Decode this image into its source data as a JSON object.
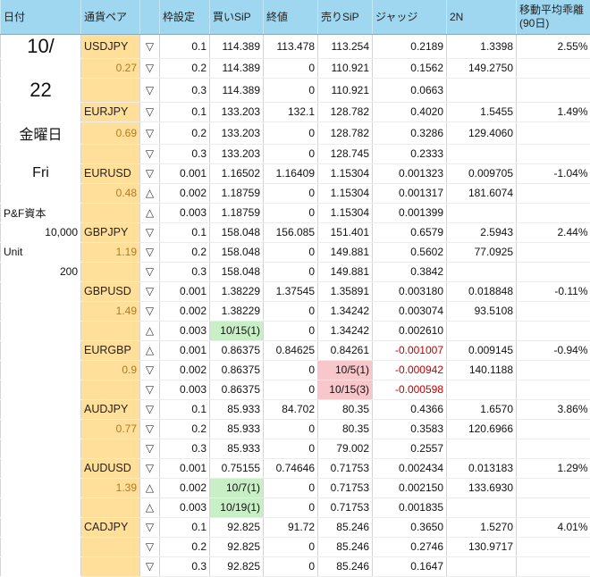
{
  "headers": [
    "日付",
    "通貨ペア",
    "",
    "枠設定",
    "買いSiP",
    "終値",
    "売りSiP",
    "ジャッジ",
    "2N",
    "移動平均乖離(90日)"
  ],
  "sidebar": [
    "10/",
    "",
    "22",
    "",
    "金曜日",
    "",
    "Fri",
    "",
    "P&F資本",
    "10,000",
    "Unit",
    "200"
  ],
  "colors": {
    "header": "#9fd7f0",
    "pair": "#ffdf9a",
    "green": "#c8efc6",
    "pink": "#f7c7cb",
    "negative": "#c00000"
  },
  "groups": [
    {
      "pair": "USDJPY",
      "leverage": "0.27",
      "ma_dev": "2.55%",
      "rows": [
        {
          "dir": "▽",
          "frame": "0.1",
          "buy": "114.389",
          "close": "113.478",
          "sell": "113.254",
          "judge": "0.2189",
          "n2": "1.3398"
        },
        {
          "dir": "▽",
          "frame": "0.2",
          "buy": "114.389",
          "close": "0",
          "sell": "110.921",
          "judge": "0.1562",
          "n2": "149.2750"
        },
        {
          "dir": "▽",
          "frame": "0.3",
          "buy": "114.389",
          "close": "0",
          "sell": "110.921",
          "judge": "0.0663",
          "n2": ""
        }
      ]
    },
    {
      "pair": "EURJPY",
      "leverage": "0.69",
      "ma_dev": "1.49%",
      "rows": [
        {
          "dir": "▽",
          "frame": "0.1",
          "buy": "133.203",
          "close": "132.1",
          "sell": "128.782",
          "judge": "0.4020",
          "n2": "1.5455"
        },
        {
          "dir": "▽",
          "frame": "0.2",
          "buy": "133.203",
          "close": "0",
          "sell": "128.782",
          "judge": "0.3286",
          "n2": "129.4060"
        },
        {
          "dir": "▽",
          "frame": "0.3",
          "buy": "133.203",
          "close": "0",
          "sell": "128.745",
          "judge": "0.2333",
          "n2": ""
        }
      ]
    },
    {
      "pair": "EURUSD",
      "leverage": "0.48",
      "ma_dev": "-1.04%",
      "rows": [
        {
          "dir": "▽",
          "frame": "0.001",
          "buy": "1.16502",
          "close": "1.16409",
          "sell": "1.15304",
          "judge": "0.001323",
          "n2": "0.009705"
        },
        {
          "dir": "△",
          "frame": "0.002",
          "buy": "1.18759",
          "close": "0",
          "sell": "1.15304",
          "judge": "0.001317",
          "n2": "181.6074"
        },
        {
          "dir": "△",
          "frame": "0.003",
          "buy": "1.18759",
          "close": "0",
          "sell": "1.15304",
          "judge": "0.001399",
          "n2": ""
        }
      ]
    },
    {
      "pair": "GBPJPY",
      "leverage": "1.19",
      "ma_dev": "2.44%",
      "rows": [
        {
          "dir": "▽",
          "frame": "0.1",
          "buy": "158.048",
          "close": "156.085",
          "sell": "151.401",
          "judge": "0.6579",
          "n2": "2.5943"
        },
        {
          "dir": "▽",
          "frame": "0.2",
          "buy": "158.048",
          "close": "0",
          "sell": "149.881",
          "judge": "0.5602",
          "n2": "77.0925"
        },
        {
          "dir": "▽",
          "frame": "0.3",
          "buy": "158.048",
          "close": "0",
          "sell": "149.881",
          "judge": "0.3842",
          "n2": ""
        }
      ]
    },
    {
      "pair": "GBPUSD",
      "leverage": "1.49",
      "ma_dev": "-0.11%",
      "rows": [
        {
          "dir": "▽",
          "frame": "0.001",
          "buy": "1.38229",
          "close": "1.37545",
          "sell": "1.35891",
          "judge": "0.003180",
          "n2": "0.018848"
        },
        {
          "dir": "▽",
          "frame": "0.002",
          "buy": "1.38229",
          "close": "0",
          "sell": "1.34242",
          "judge": "0.003074",
          "n2": "93.5108"
        },
        {
          "dir": "△",
          "frame": "0.003",
          "buy": "10/15(1)",
          "buy_hl": "green",
          "close": "0",
          "sell": "1.34242",
          "judge": "0.002610",
          "n2": ""
        }
      ]
    },
    {
      "pair": "EURGBP",
      "leverage": "0.9",
      "ma_dev": "-0.94%",
      "rows": [
        {
          "dir": "△",
          "frame": "0.001",
          "buy": "0.86375",
          "close": "0.84625",
          "sell": "0.84261",
          "judge": "-0.001007",
          "judge_neg": true,
          "n2": "0.009145"
        },
        {
          "dir": "▽",
          "frame": "0.002",
          "buy": "0.86375",
          "close": "0",
          "sell": "10/5(1)",
          "sell_hl": "pink",
          "judge": "-0.000942",
          "judge_neg": true,
          "n2": "140.1188"
        },
        {
          "dir": "▽",
          "frame": "0.003",
          "buy": "0.86375",
          "close": "0",
          "sell": "10/15(3)",
          "sell_hl": "pink",
          "judge": "-0.000598",
          "judge_neg": true,
          "n2": ""
        }
      ]
    },
    {
      "pair": "AUDJPY",
      "leverage": "0.77",
      "ma_dev": "3.86%",
      "rows": [
        {
          "dir": "▽",
          "frame": "0.1",
          "buy": "85.933",
          "close": "84.702",
          "sell": "80.35",
          "judge": "0.4366",
          "n2": "1.6570"
        },
        {
          "dir": "▽",
          "frame": "0.2",
          "buy": "85.933",
          "close": "0",
          "sell": "80.35",
          "judge": "0.3583",
          "n2": "120.6966"
        },
        {
          "dir": "▽",
          "frame": "0.3",
          "buy": "85.933",
          "close": "0",
          "sell": "79.002",
          "judge": "0.2557",
          "n2": ""
        }
      ]
    },
    {
      "pair": "AUDUSD",
      "leverage": "1.39",
      "ma_dev": "1.29%",
      "rows": [
        {
          "dir": "▽",
          "frame": "0.001",
          "buy": "0.75155",
          "close": "0.74646",
          "sell": "0.71753",
          "judge": "0.002434",
          "n2": "0.013183"
        },
        {
          "dir": "△",
          "frame": "0.002",
          "buy": "10/7(1)",
          "buy_hl": "green",
          "close": "0",
          "sell": "0.71753",
          "judge": "0.002150",
          "n2": "133.6930"
        },
        {
          "dir": "△",
          "frame": "0.003",
          "buy": "10/19(1)",
          "buy_hl": "green",
          "close": "0",
          "sell": "0.71753",
          "judge": "0.001835",
          "n2": ""
        }
      ]
    },
    {
      "pair": "CADJPY",
      "leverage": "",
      "ma_dev": "4.01%",
      "rows": [
        {
          "dir": "▽",
          "frame": "0.1",
          "buy": "92.825",
          "close": "91.72",
          "sell": "85.246",
          "judge": "0.3650",
          "n2": "1.5270"
        },
        {
          "dir": "▽",
          "frame": "0.2",
          "buy": "92.825",
          "close": "0",
          "sell": "85.246",
          "judge": "0.2746",
          "n2": "130.9717"
        },
        {
          "dir": "▽",
          "frame": "0.3",
          "buy": "92.825",
          "close": "0",
          "sell": "85.246",
          "judge": "0.1647",
          "n2": ""
        }
      ]
    }
  ]
}
